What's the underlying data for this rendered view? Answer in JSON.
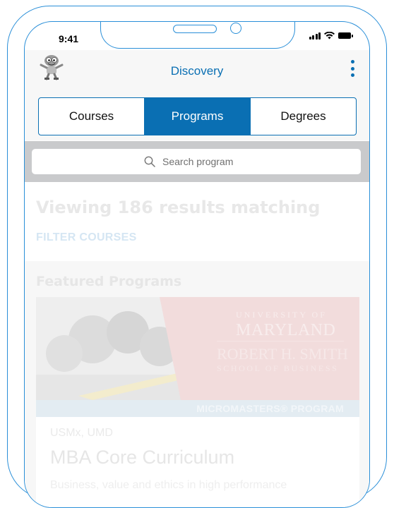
{
  "status_bar": {
    "time": "9:41"
  },
  "app_bar": {
    "title": "Discovery",
    "logo_icon": "mascot-logo-icon",
    "menu_icon": "more-vertical-icon"
  },
  "tabs": [
    {
      "label": "Courses",
      "active": false
    },
    {
      "label": "Programs",
      "active": true
    },
    {
      "label": "Degrees",
      "active": false
    }
  ],
  "search": {
    "placeholder": "Search program",
    "icon": "search-icon"
  },
  "results": {
    "text": "Viewing 186 results matching"
  },
  "filter": {
    "label": "FILTER COURSES"
  },
  "featured": {
    "heading": "Featured Programs",
    "card": {
      "image_text": {
        "university_small": "UNIVERSITY OF",
        "university_large": "MARYLAND",
        "school_name": "ROBERT H. SMITH",
        "school_sub": "SCHOOL OF BUSINESS"
      },
      "badge": "MICROMASTERS® PROGRAM",
      "school": "USMx, UMD",
      "title": "MBA Core Curriculum",
      "description": "Business, value and ethics in high performance"
    }
  },
  "colors": {
    "accent": "#0a6fb3",
    "frame": "#2a8fd8"
  }
}
